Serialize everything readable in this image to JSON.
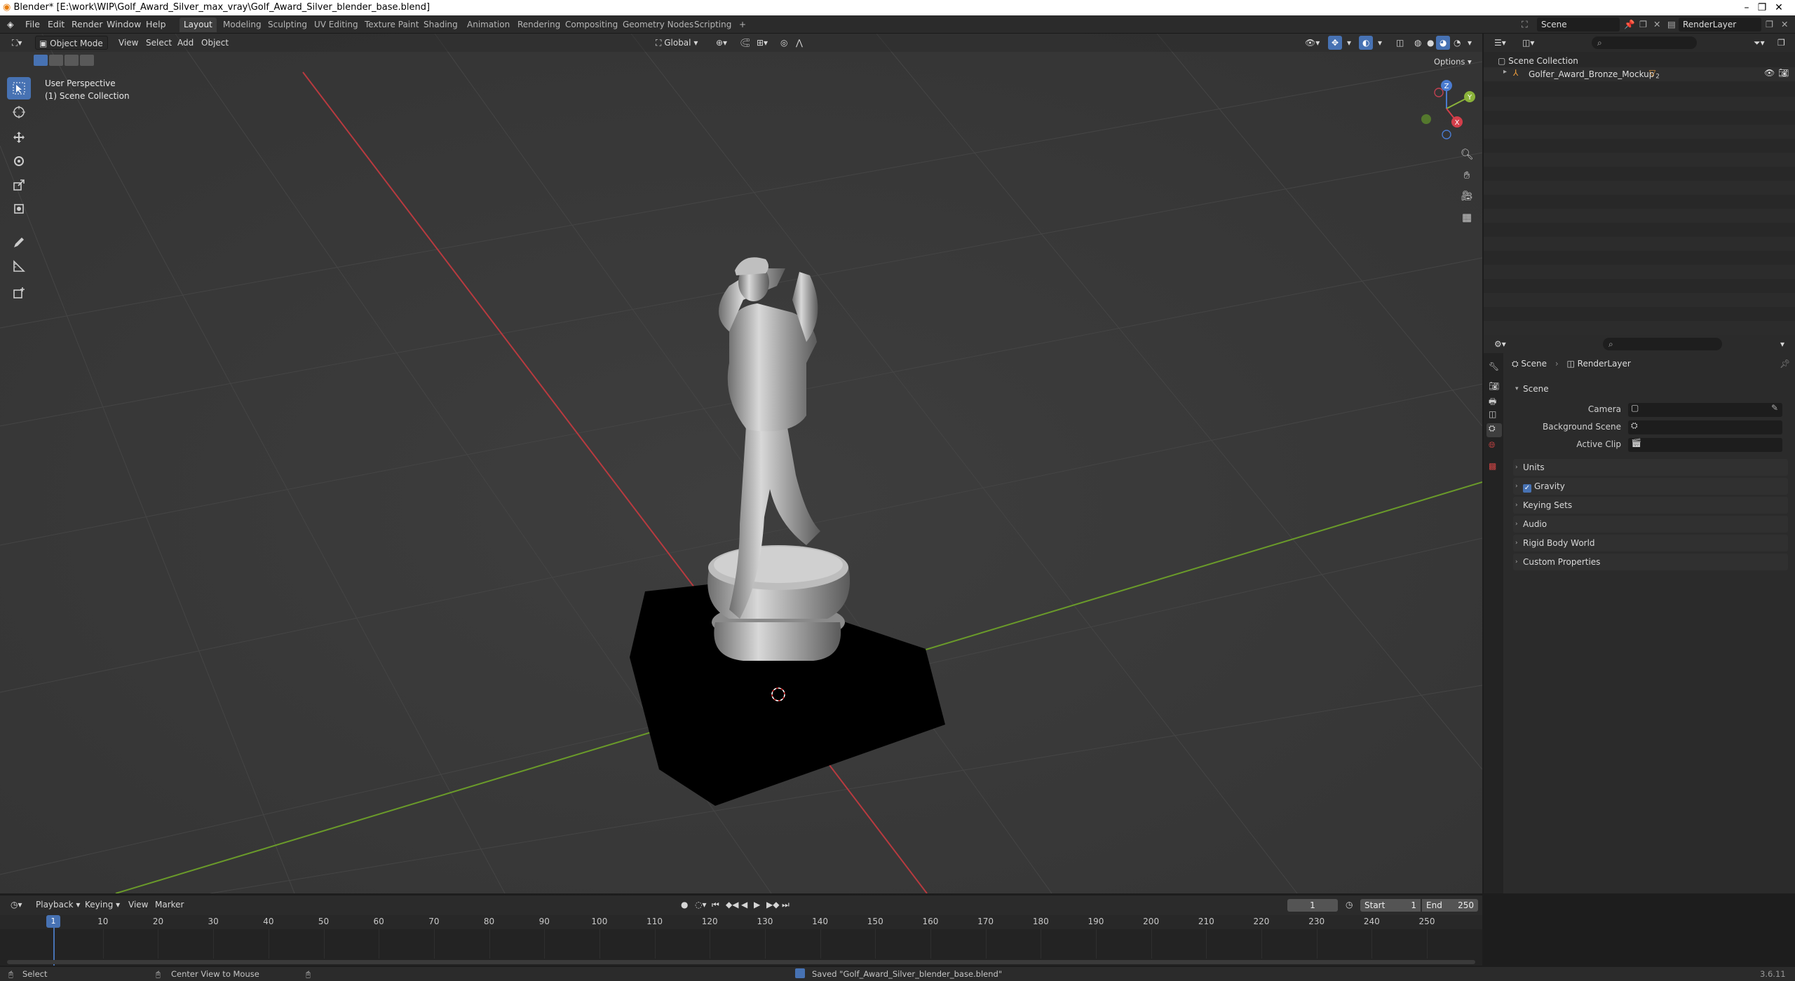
{
  "window": {
    "title": "Blender* [E:\\work\\WIP\\Golf_Award_Silver_max_vray\\Golf_Award_Silver_blender_base.blend]",
    "controls": [
      "–",
      "❐",
      "✕"
    ]
  },
  "menubar": {
    "items": [
      "File",
      "Edit",
      "Render",
      "Window",
      "Help"
    ],
    "workspaces": [
      "Layout",
      "Modeling",
      "Sculpting",
      "UV Editing",
      "Texture Paint",
      "Shading",
      "Animation",
      "Rendering",
      "Compositing",
      "Geometry Nodes",
      "Scripting"
    ],
    "active_workspace": "Layout",
    "add_workspace": "+",
    "scene": "Scene",
    "view_layer": "RenderLayer"
  },
  "viewport": {
    "mode": "Object Mode",
    "menus": [
      "View",
      "Select",
      "Add",
      "Object"
    ],
    "orientation": "Global",
    "options_label": "Options",
    "overlay_line1": "User Perspective",
    "overlay_line2": "(1) Scene Collection",
    "gizmo_axes": [
      "X",
      "Y",
      "Z"
    ],
    "tools": [
      "select-box",
      "cursor",
      "move",
      "rotate",
      "scale",
      "transform",
      "annotate",
      "measure",
      "add-cube"
    ]
  },
  "outliner": {
    "root": "Scene Collection",
    "items": [
      {
        "name": "Golfer_Award_Bronze_Mockup",
        "badge": "2"
      }
    ]
  },
  "properties": {
    "breadcrumb_scene": "Scene",
    "breadcrumb_layer": "RenderLayer",
    "panel_title": "Scene",
    "fields": [
      {
        "label": "Camera",
        "value": ""
      },
      {
        "label": "Background Scene",
        "value": ""
      },
      {
        "label": "Active Clip",
        "value": ""
      }
    ],
    "sections": [
      "Units",
      "Gravity",
      "Keying Sets",
      "Audio",
      "Rigid Body World",
      "Custom Properties"
    ],
    "gravity_checked": true
  },
  "timeline": {
    "menus": [
      "Playback",
      "Keying",
      "View",
      "Marker"
    ],
    "current_frame": "1",
    "start_label": "Start",
    "start": "1",
    "end_label": "End",
    "end": "250",
    "ticks": [
      "1",
      "10",
      "20",
      "30",
      "40",
      "50",
      "60",
      "70",
      "80",
      "90",
      "100",
      "110",
      "120",
      "130",
      "140",
      "150",
      "160",
      "170",
      "180",
      "190",
      "200",
      "210",
      "220",
      "230",
      "240",
      "250"
    ]
  },
  "statusbar": {
    "select": "Select",
    "center": "Center View to Mouse",
    "message": "Saved \"Golf_Award_Silver_blender_base.blend\"",
    "version": "3.6.11"
  },
  "colors": {
    "accent": "#4772b3",
    "x_axis": "#b83a3f",
    "y_axis": "#6a9a2a",
    "viewport_bg": "#393939"
  }
}
